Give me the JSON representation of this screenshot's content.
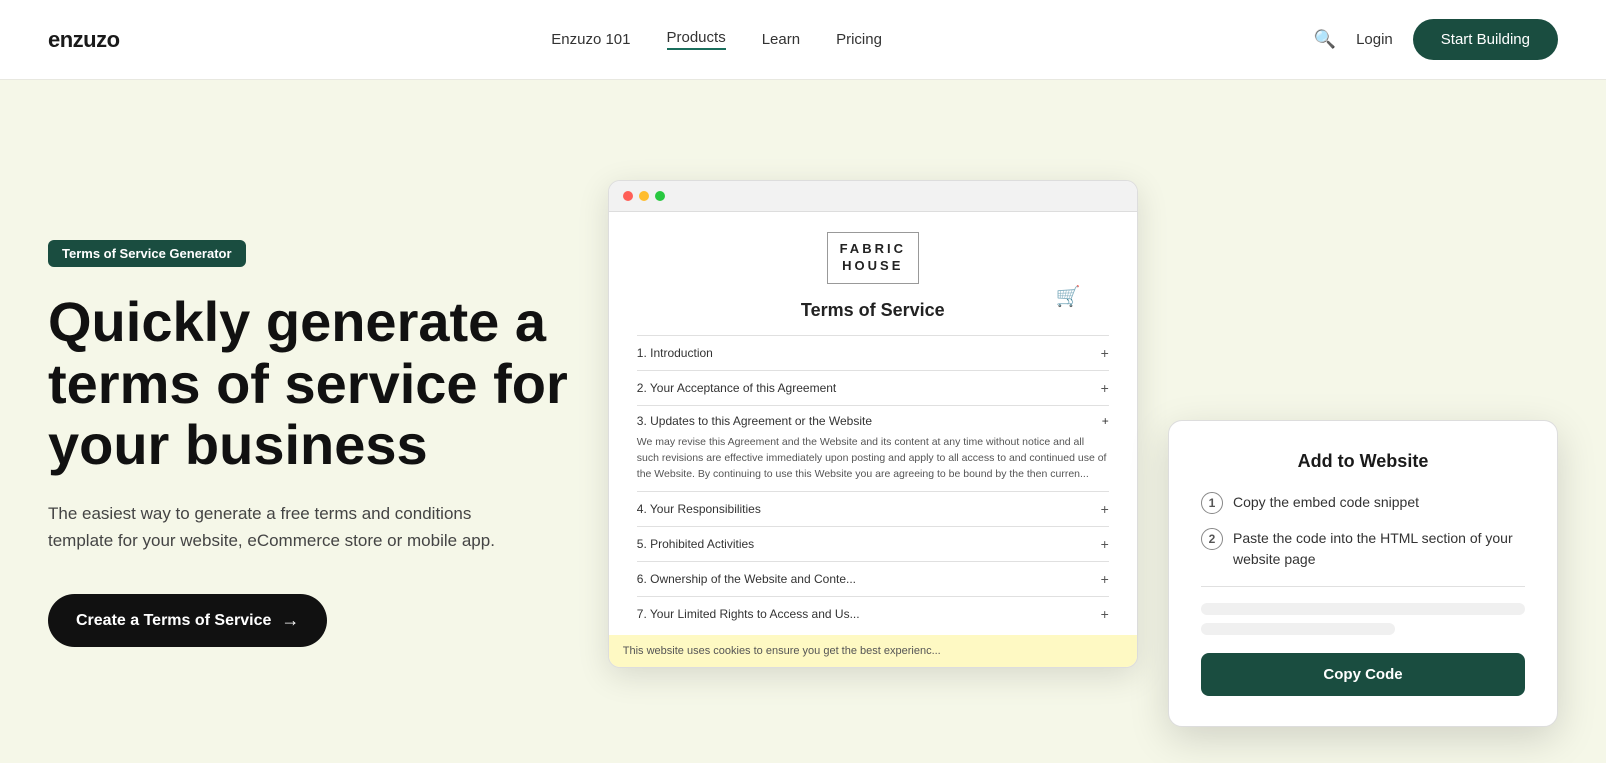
{
  "nav": {
    "logo": "enzuzo",
    "links": [
      {
        "label": "Enzuzo 101",
        "id": "enzuzo101"
      },
      {
        "label": "Products",
        "id": "products",
        "active": true
      },
      {
        "label": "Learn",
        "id": "learn"
      },
      {
        "label": "Pricing",
        "id": "pricing"
      }
    ],
    "login_label": "Login",
    "cta_label": "Start Building",
    "search_icon": "🔍"
  },
  "hero": {
    "badge": "Terms of Service Generator",
    "headline_line1": "Quickly generate a",
    "headline_line2": "terms of service for",
    "headline_line3": "your business",
    "subtext": "The easiest way to generate a free terms and conditions template for your website, eCommerce store or mobile app.",
    "cta_label": "Create a Terms of Service",
    "cta_arrow": "→"
  },
  "browser_mock": {
    "logo_line1": "FABRIC",
    "logo_line2": "HOUSE",
    "tos_title": "Terms of Service",
    "rows": [
      {
        "label": "1. Introduction"
      },
      {
        "label": "2. Your Acceptance of this Agreement"
      },
      {
        "label": "3. Updates to this Agreement or the Website",
        "expanded": true
      },
      {
        "label": "4. Your Responsibilities"
      },
      {
        "label": "5. Prohibited Activities"
      },
      {
        "label": "6. Ownership of the Website and Conte..."
      },
      {
        "label": "7. Your Limited Rights to Access and Us..."
      }
    ],
    "expanded_text": "We may revise this Agreement and the Website and its content at any time without notice and all such revisions are effective immediately upon posting and apply to all access to and continued use of the Website. By continuing to use this Website you are agreeing to be bound by the then curren...",
    "cookie_text": "This website uses cookies to ensure you get the best experienc..."
  },
  "add_to_website": {
    "title": "Add to Website",
    "step1": "Copy the embed code snippet",
    "step2": "Paste the code into the HTML section of your website page",
    "copy_btn": "Copy Code"
  },
  "colors": {
    "primary_dark": "#1a4d40",
    "bg": "#f5f7e8",
    "white": "#ffffff"
  }
}
